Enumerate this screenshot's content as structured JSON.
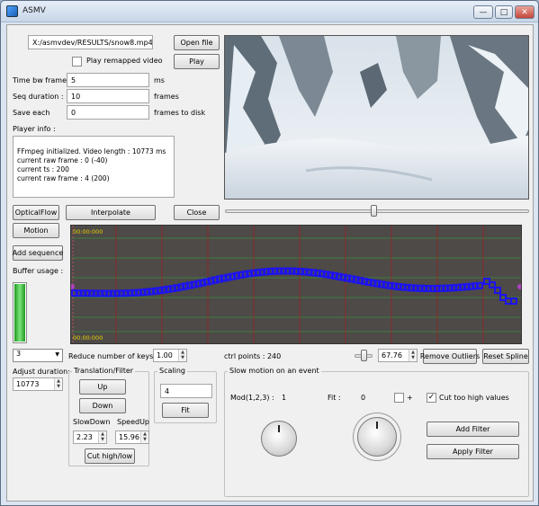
{
  "window": {
    "title": "ASMV"
  },
  "file": {
    "path": "X:/asmvdev/RESULTS/snow8.mp4",
    "open_label": "Open file",
    "play_remapped_label": "Play remapped video",
    "play_label": "Play"
  },
  "fields": {
    "time_bw_frame": {
      "label": "Time bw frame :",
      "value": "5",
      "unit": "ms"
    },
    "seq_duration": {
      "label": "Seq duration :",
      "value": "10",
      "unit": "frames"
    },
    "save_each": {
      "label": "Save each",
      "value": "0",
      "unit": "frames to disk"
    }
  },
  "player_info": {
    "label": "Player info :",
    "lines": [
      "FFmpeg initialized. Video length : 10773 ms",
      "current raw frame : 0 (-40)",
      "current ts : 200",
      "current raw frame : 4 (200)"
    ]
  },
  "buttons": {
    "optical_flow": "OpticalFlow",
    "interpolate": "Interpolate",
    "close": "Close",
    "motion": "Motion",
    "add_sequence": "Add sequence"
  },
  "buffer": {
    "label": "Buffer usage :",
    "level": 1.0,
    "color": "#2fc42f"
  },
  "timeline": {
    "start_label": "00:00:000",
    "end_label": "00:00:000",
    "curve_color": "#1d13f0",
    "background": "#4d4a48",
    "grid_green": "#3f7f3f",
    "grid_red": "#8a2a2a"
  },
  "bottom_bar": {
    "combo_value": "3",
    "reduce_label": "Reduce number of keys by",
    "reduce_value": "1.00",
    "ctrl_points": "ctrl points : 240",
    "zoom_value": "67.76",
    "remove_outliers": "Remove Outliers",
    "reset_spline": "Reset Spline"
  },
  "adjust": {
    "label": "Adjust duration:",
    "value": "10773"
  },
  "translation": {
    "title": "Translation/Filter",
    "up": "Up",
    "down": "Down",
    "slowdown_label": "SlowDown",
    "speedup_label": "SpeedUp",
    "slowdown_value": "2.23",
    "speedup_value": "15.96",
    "cut": "Cut high/low"
  },
  "scaling": {
    "title": "Scaling",
    "value": "4",
    "fit": "Fit"
  },
  "slowmo": {
    "title": "Slow motion on an event",
    "mod_label": "Mod(1,2,3) :",
    "mod_value": "1",
    "fit_label": "Fit :",
    "fit_value": "0",
    "plus_label": "+",
    "cut_too_high_label": "Cut too high values",
    "cut_too_high_checked": true,
    "add_filter": "Add Filter",
    "apply_filter": "Apply Filter"
  },
  "video_slider": {
    "position": 0.49
  },
  "timeline_slider": {
    "position": 0.35
  }
}
